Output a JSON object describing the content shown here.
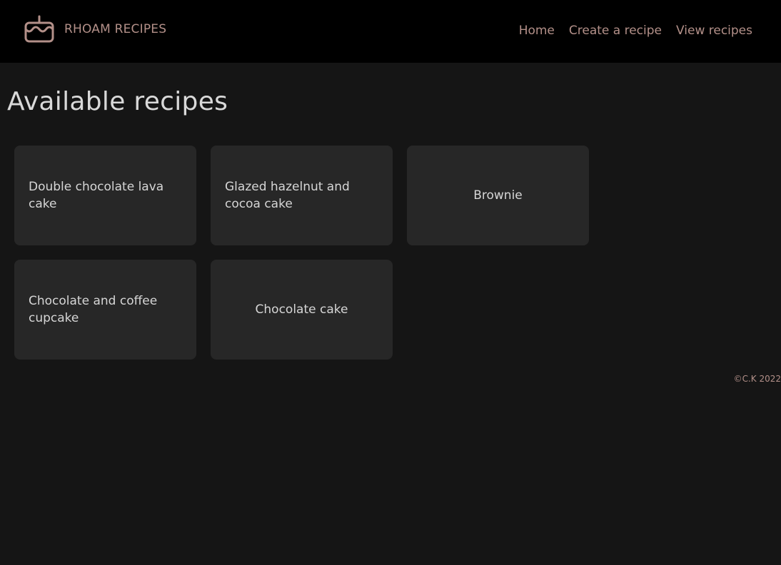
{
  "brand": {
    "name": "RHOAM RECIPES",
    "icon": "cake-icon"
  },
  "nav": {
    "items": [
      {
        "label": "Home"
      },
      {
        "label": "Create a recipe"
      },
      {
        "label": "View recipes"
      }
    ]
  },
  "main": {
    "title": "Available recipes",
    "recipes": [
      {
        "title": "Double chocolate lava cake"
      },
      {
        "title": "Glazed hazelnut and cocoa cake"
      },
      {
        "title": "Brownie"
      },
      {
        "title": "Chocolate and coffee cupcake"
      },
      {
        "title": "Chocolate cake"
      }
    ]
  },
  "footer": {
    "text": "©C.K 2022"
  },
  "colors": {
    "header_bg": "#000000",
    "page_bg": "#151515",
    "card_bg": "#272727",
    "accent": "#b39089",
    "text": "#d9d9d9"
  }
}
